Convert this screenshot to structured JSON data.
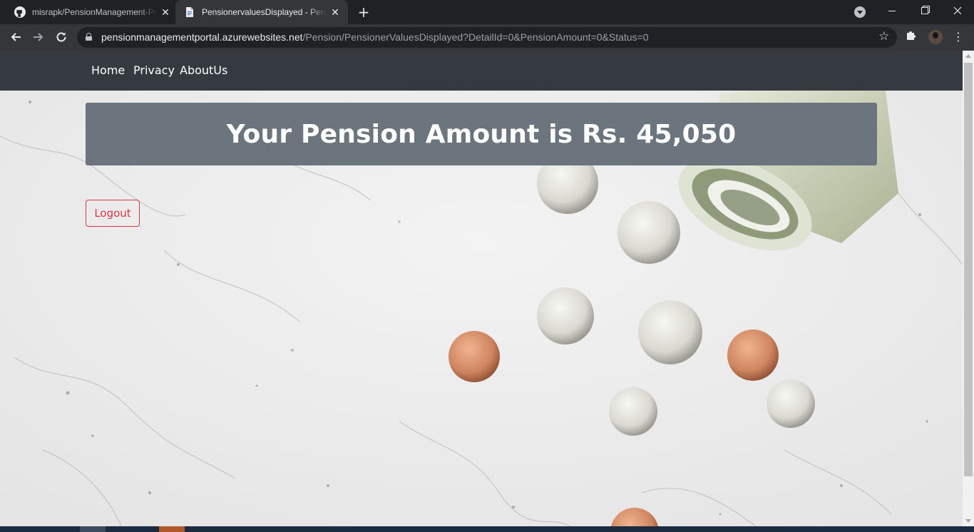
{
  "browser": {
    "tabs": [
      {
        "title": "misrapk/PensionManagement-Portal",
        "icon": "github-icon",
        "active": false
      },
      {
        "title": "PensionervaluesDisplayed - PensionManagementPortal",
        "icon": "document-icon",
        "active": true
      }
    ],
    "close_glyph": "✕",
    "new_tab_glyph": "+",
    "url_host": "pensionmanagementportal.azurewebsites.net",
    "url_path": "/Pension/PensionerValuesDisplayed?DetailId=0&PensionAmount=0&Status=0"
  },
  "site": {
    "nav": {
      "home": "Home",
      "privacy": "Privacy",
      "about": "AboutUs"
    },
    "banner_text": "Your Pension Amount is Rs. 45,050",
    "logout_label": "Logout"
  },
  "colors": {
    "navbar": "#343a40",
    "banner": "#6c757d",
    "logout": "#dc3545"
  }
}
